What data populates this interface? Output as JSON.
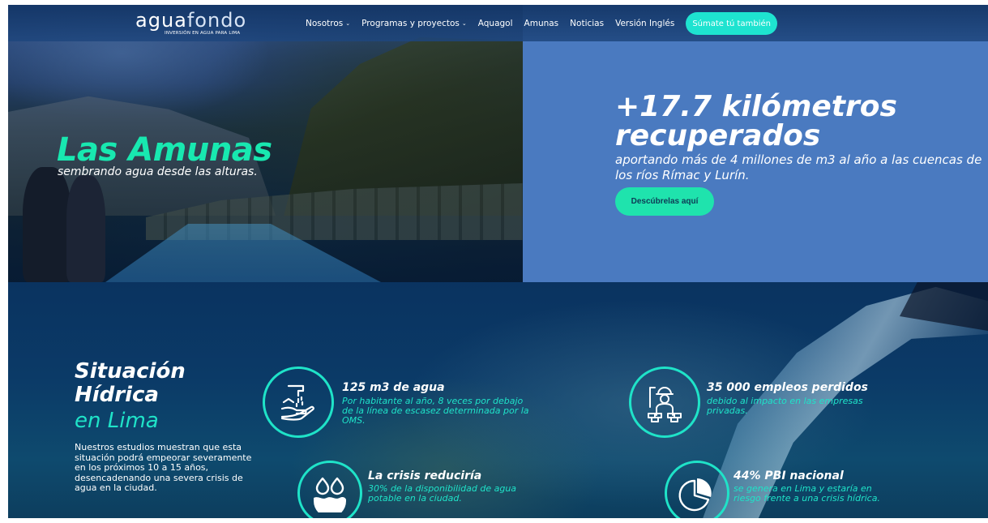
{
  "header": {
    "logo": {
      "word_main": "agua",
      "word_accent": "fondo",
      "tagline": "INVERSIÓN EN AGUA PARA LIMA"
    },
    "nav": [
      {
        "label": "Nosotros",
        "has_dropdown": true
      },
      {
        "label": "Programas y proyectos",
        "has_dropdown": true
      },
      {
        "label": "Aquagol",
        "has_dropdown": false
      },
      {
        "label": "Amunas",
        "has_dropdown": false
      },
      {
        "label": "Noticias",
        "has_dropdown": false
      },
      {
        "label": "Versión Inglés",
        "has_dropdown": false
      }
    ],
    "cta_label": "Súmate tú también",
    "chevron_glyph": "⌄"
  },
  "hero": {
    "title": "Las Amunas",
    "subtitle": "sembrando agua desde las alturas.",
    "panel": {
      "headline": "+17.7 kilómetros recuperados",
      "description": "aportando más de 4 millones de m3 al año a las cuencas de los ríos Rímac y Lurín.",
      "button_label": "Descúbrelas aquí"
    }
  },
  "situation": {
    "title": "Situación Hídrica",
    "subtitle": "en Lima",
    "body": "Nuestros estudios muestran que esta situación podrá empeorar severamente en los próximos 10 a 15 años, desencadenando una severa crisis de agua en la ciudad.",
    "stats": [
      {
        "icon": "hand-washing-icon",
        "title": "125 m3 de agua",
        "desc": "Por habitante al año, 8 veces por debajo de la línea de escasez determinada por la OMS."
      },
      {
        "icon": "construction-worker-icon",
        "title": "35 000 empleos perdidos",
        "desc": "debido al impacto en las empresas privadas."
      },
      {
        "icon": "water-drops-icon",
        "title": "La crisis reduciría",
        "desc": "30% de la disponibilidad de agua potable en la ciudad."
      },
      {
        "icon": "pie-chart-icon",
        "title": "44% PBI nacional",
        "desc": "se genera en Lima y estaría en riesgo frente a una crisis hídrica."
      }
    ]
  },
  "colors": {
    "accent": "#1fe3c8",
    "hero_accent": "#18e8b0",
    "panel_blue": "#4a7ac0",
    "navy": "#0b3a67"
  }
}
